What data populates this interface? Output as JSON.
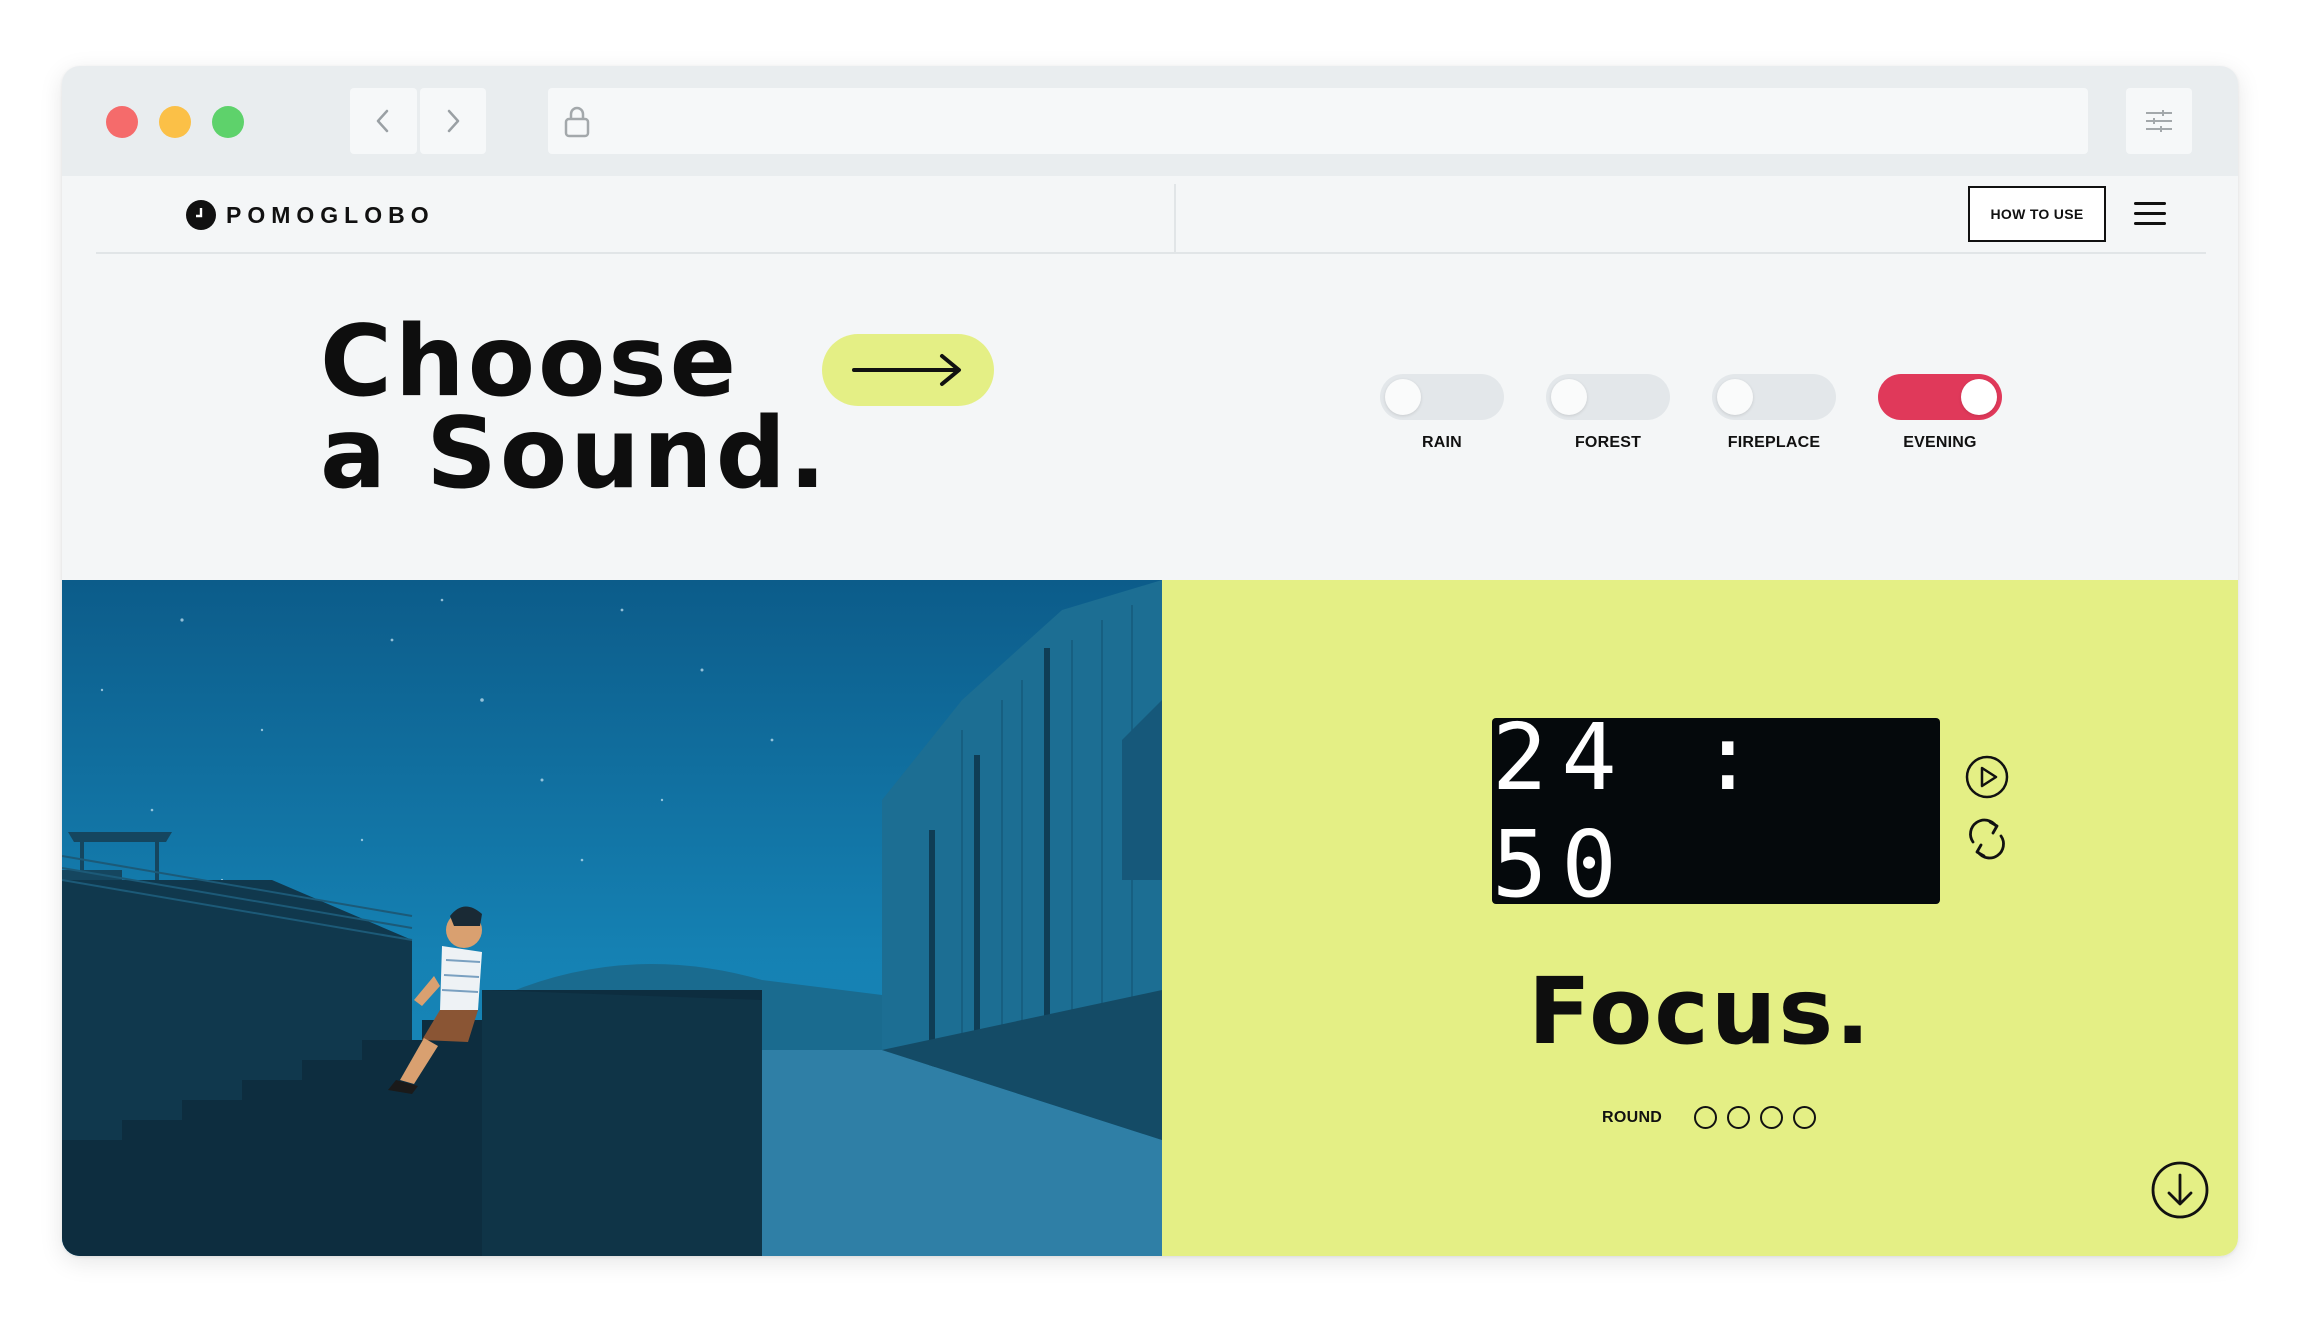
{
  "browser": {
    "icons": {
      "back": "chevron-left-icon",
      "forward": "chevron-right-icon",
      "lock": "lock-icon",
      "settings": "sliders-icon"
    }
  },
  "header": {
    "logo_text": "POMOGLOBO",
    "how_to_use_label": "HOW TO USE",
    "menu_icon": "hamburger-icon"
  },
  "hero": {
    "title_line1": "Choose",
    "title_line2": "a Sound.",
    "arrow_icon": "arrow-right-icon",
    "accent_color": "#e4ef85"
  },
  "sounds": [
    {
      "label": "RAIN",
      "on": false
    },
    {
      "label": "FOREST",
      "on": false
    },
    {
      "label": "FIREPLACE",
      "on": false
    },
    {
      "label": "EVENING",
      "on": true
    }
  ],
  "toggle_on_color": "#e0395a",
  "timer": {
    "display": "24:50",
    "mode": "Focus.",
    "round_label": "ROUND",
    "rounds_total": 4,
    "rounds_completed": 0,
    "play_icon": "play-icon",
    "reset_icon": "refresh-icon"
  },
  "scroll_icon": "arrow-down-circle-icon"
}
